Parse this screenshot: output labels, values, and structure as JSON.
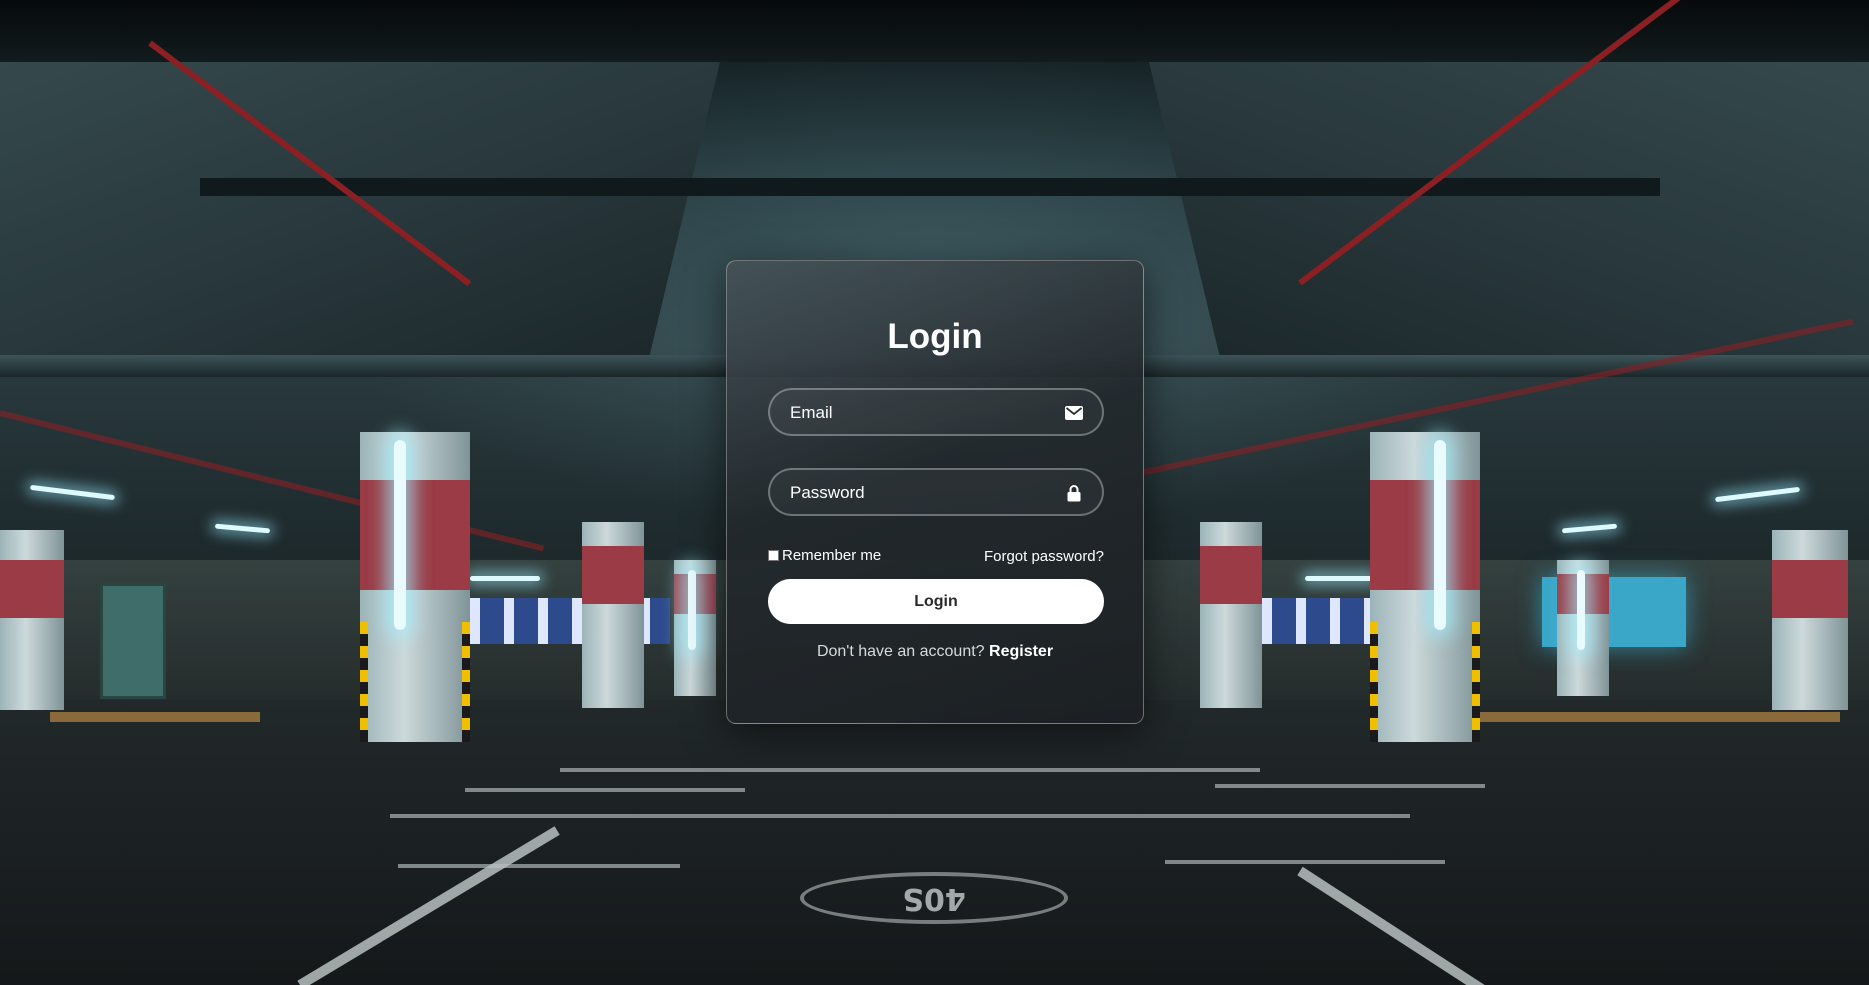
{
  "login_form": {
    "title": "Login",
    "email": {
      "placeholder": "Email",
      "value": "",
      "icon": "envelope-icon"
    },
    "password": {
      "placeholder": "Password",
      "value": "",
      "icon": "lock-icon"
    },
    "remember_me": {
      "label": "Remember me",
      "checked": false
    },
    "forgot_password_label": "Forgot password?",
    "submit_label": "Login",
    "register_prompt": "Don't have an account?",
    "register_link_label": "Register"
  },
  "background": {
    "floor_marking": "40S"
  },
  "colors": {
    "card_border": "#ffffff",
    "button_bg": "#ffffff",
    "button_text": "#2a2a2a",
    "text": "#ffffff"
  }
}
